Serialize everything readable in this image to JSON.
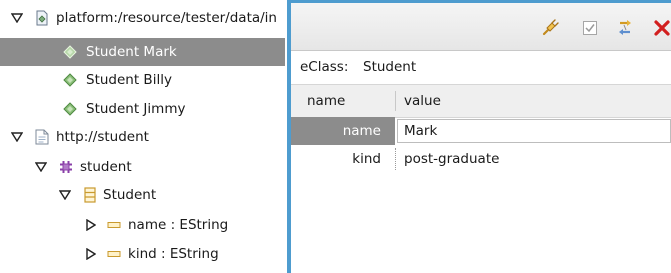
{
  "tree": {
    "rows": [
      {
        "label": "platform:/resource/tester/data/in",
        "icon": "model-resource-icon",
        "twisty": "expanded"
      },
      {
        "label": "Student Mark",
        "icon": "instance-diamond-icon",
        "twisty": "none",
        "selected": true
      },
      {
        "label": "Student Billy",
        "icon": "instance-diamond-icon",
        "twisty": "none"
      },
      {
        "label": "Student Jimmy",
        "icon": "instance-diamond-icon",
        "twisty": "none"
      },
      {
        "label": "http://student",
        "icon": "document-icon",
        "twisty": "expanded"
      },
      {
        "label": "student",
        "icon": "package-icon",
        "twisty": "expanded"
      },
      {
        "label": "Student",
        "icon": "eclass-icon",
        "twisty": "expanded"
      },
      {
        "label": "name : EString",
        "icon": "attribute-icon",
        "twisty": "collapsed"
      },
      {
        "label": "kind : EString",
        "icon": "attribute-icon",
        "twisty": "collapsed"
      }
    ]
  },
  "panel": {
    "toolbar": {
      "buttons": [
        {
          "icon": "link-icon"
        },
        {
          "icon": "checkbox-icon"
        },
        {
          "icon": "sync-arrows-icon"
        },
        {
          "icon": "delete-x-icon"
        }
      ]
    },
    "eclass": {
      "label": "eClass:",
      "value": "Student"
    },
    "table": {
      "headers": {
        "name": "name",
        "value": "value"
      },
      "rows": [
        {
          "name": "name",
          "value": "Mark",
          "selected": true
        },
        {
          "name": "kind",
          "value": "post-graduate",
          "selected": false
        }
      ]
    }
  },
  "colors": {
    "selection": "#8c8c8c",
    "panel_frame": "#4e9ccf",
    "toolbar_bg": "#eeeeee"
  }
}
